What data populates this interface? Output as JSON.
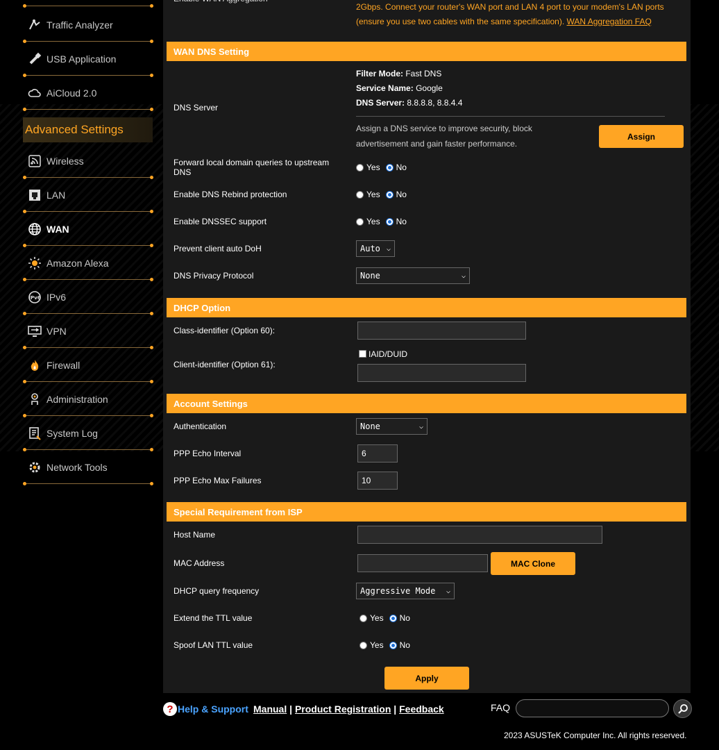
{
  "sidebar": {
    "items_top": [
      {
        "label": "Traffic Analyzer",
        "icon": "traffic-analyzer-icon"
      },
      {
        "label": "USB Application",
        "icon": "usb-application-icon"
      },
      {
        "label": "AiCloud 2.0",
        "icon": "aicloud-icon"
      }
    ],
    "advanced_header": "Advanced Settings",
    "items": [
      {
        "label": "Wireless",
        "icon": "wireless-icon"
      },
      {
        "label": "LAN",
        "icon": "lan-icon"
      },
      {
        "label": "WAN",
        "icon": "wan-globe-icon",
        "active": true
      },
      {
        "label": "Amazon Alexa",
        "icon": "alexa-icon"
      },
      {
        "label": "IPv6",
        "icon": "ipv6-icon"
      },
      {
        "label": "VPN",
        "icon": "vpn-icon"
      },
      {
        "label": "Firewall",
        "icon": "firewall-icon"
      },
      {
        "label": "Administration",
        "icon": "administration-icon"
      },
      {
        "label": "System Log",
        "icon": "system-log-icon"
      },
      {
        "label": "Network Tools",
        "icon": "network-tools-icon"
      }
    ]
  },
  "wan_aggregation": {
    "partial_label": "Enable WAN Aggregation",
    "line1": "2Gbps. Connect your router's WAN port and LAN 4 port to your modem's LAN ports",
    "line2": "(ensure you use two cables with the same specification).",
    "faq_link": "WAN Aggregation FAQ"
  },
  "dns": {
    "section": "WAN DNS Setting",
    "label": "DNS Server",
    "filter_mode_label": "Filter Mode:",
    "filter_mode": "Fast DNS",
    "service_name_label": "Service Name:",
    "service_name": "Google",
    "dns_server_label": "DNS Server:",
    "dns_server": "8.8.8.8, 8.8.4.4",
    "assign_desc": "Assign a DNS service to improve security, block advertisement and gain faster performance.",
    "assign_button": "Assign",
    "forward_label": "Forward local domain queries to upstream DNS",
    "rebind_label": "Enable DNS Rebind protection",
    "dnssec_label": "Enable DNSSEC support",
    "doh_label": "Prevent client auto DoH",
    "doh_value": "Auto",
    "privacy_label": "DNS Privacy Protocol",
    "privacy_value": "None"
  },
  "radio": {
    "yes": "Yes",
    "no": "No"
  },
  "dhcp": {
    "section": "DHCP Option",
    "class_label": "Class-identifier (Option 60):",
    "class_value": "",
    "client_label": "Client-identifier (Option 61):",
    "iaid_label": "IAID/DUID",
    "client_value": ""
  },
  "account": {
    "section": "Account Settings",
    "auth_label": "Authentication",
    "auth_value": "None",
    "echo_interval_label": "PPP Echo Interval",
    "echo_interval": "6",
    "echo_fail_label": "PPP Echo Max Failures",
    "echo_fail": "10"
  },
  "isp": {
    "section": "Special Requirement from ISP",
    "host_label": "Host Name",
    "host_value": "",
    "mac_label": "MAC Address",
    "mac_value": "",
    "mac_clone": "MAC Clone",
    "dhcp_freq_label": "DHCP query frequency",
    "dhcp_freq_value": "Aggressive Mode",
    "ttl_label": "Extend the TTL value",
    "spoof_label": "Spoof LAN TTL value"
  },
  "apply_button": "Apply",
  "footer": {
    "help": "Help & Support",
    "manual": "Manual",
    "sep": "|",
    "product_reg": "Product Registration",
    "feedback": "Feedback",
    "faq": "FAQ",
    "copyright": "2023 ASUSTeK Computer Inc. All rights reserved."
  },
  "colors": {
    "accent": "#ffa523",
    "panel": "#1a1a1a",
    "link_blue": "#4aa3ff"
  }
}
